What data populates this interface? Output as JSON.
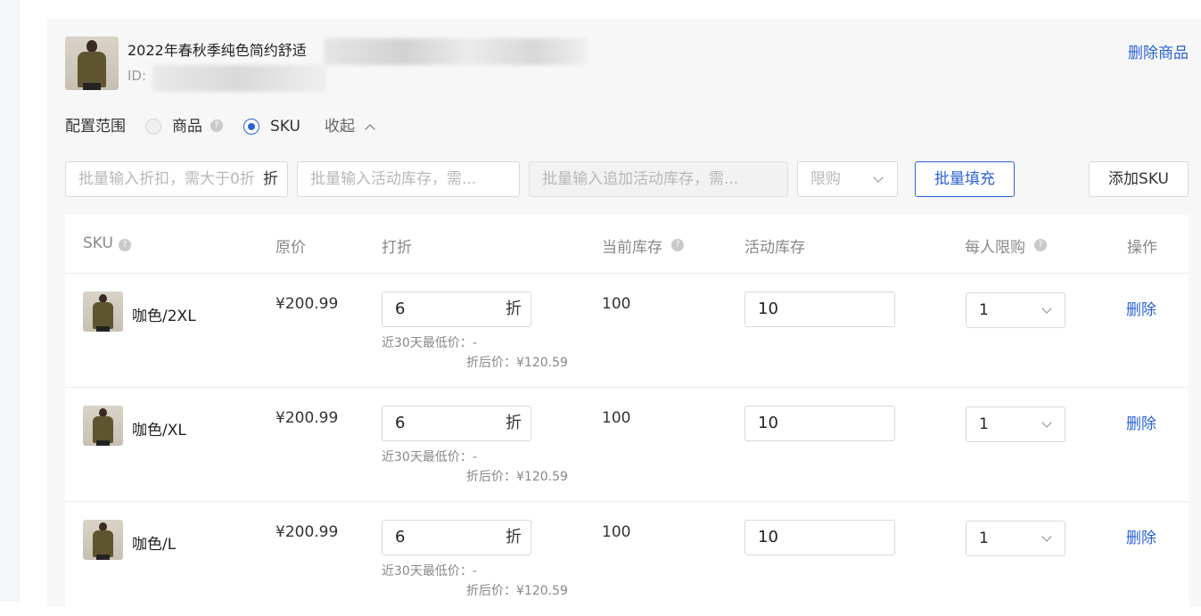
{
  "product": {
    "title": "2022年春秋季纯色简约舒适",
    "id_label": "ID:",
    "delete_label": "删除商品"
  },
  "scope": {
    "label": "配置范围",
    "option_product": "商品",
    "option_sku": "SKU",
    "selected": "SKU",
    "collapse_label": "收起"
  },
  "batch": {
    "discount_placeholder": "批量输入折扣，需大于0折",
    "discount_suffix": "折",
    "stock_placeholder": "批量输入活动库存，需...",
    "extra_stock_placeholder": "批量输入追加活动库存，需...",
    "limit_placeholder": "限购",
    "fill_label": "批量填充",
    "add_sku_label": "添加SKU"
  },
  "table": {
    "headers": {
      "sku": "SKU",
      "original_price": "原价",
      "discount": "打折",
      "current_stock": "当前库存",
      "activity_stock": "活动库存",
      "per_person_limit": "每人限购",
      "action": "操作"
    },
    "rows": [
      {
        "name": "咖色/2XL",
        "price": "¥200.99",
        "discount": "6",
        "discount_suffix": "折",
        "lowest_30": "近30天最低价：-",
        "after_price": "折后价：¥120.59",
        "stock": "100",
        "activity_stock": "10",
        "limit": "1",
        "action": "删除"
      },
      {
        "name": "咖色/XL",
        "price": "¥200.99",
        "discount": "6",
        "discount_suffix": "折",
        "lowest_30": "近30天最低价：-",
        "after_price": "折后价：¥120.59",
        "stock": "100",
        "activity_stock": "10",
        "limit": "1",
        "action": "删除"
      },
      {
        "name": "咖色/L",
        "price": "¥200.99",
        "discount": "6",
        "discount_suffix": "折",
        "lowest_30": "近30天最低价：-",
        "after_price": "折后价：¥120.59",
        "stock": "100",
        "activity_stock": "10",
        "limit": "1",
        "action": "删除"
      }
    ]
  },
  "icons": {
    "help": "question-circle-icon",
    "collapse": "chevron-up-icon",
    "dropdown": "chevron-down-icon"
  },
  "colors": {
    "accent": "#2a63d6",
    "panel_bg": "#f7f7f7"
  }
}
